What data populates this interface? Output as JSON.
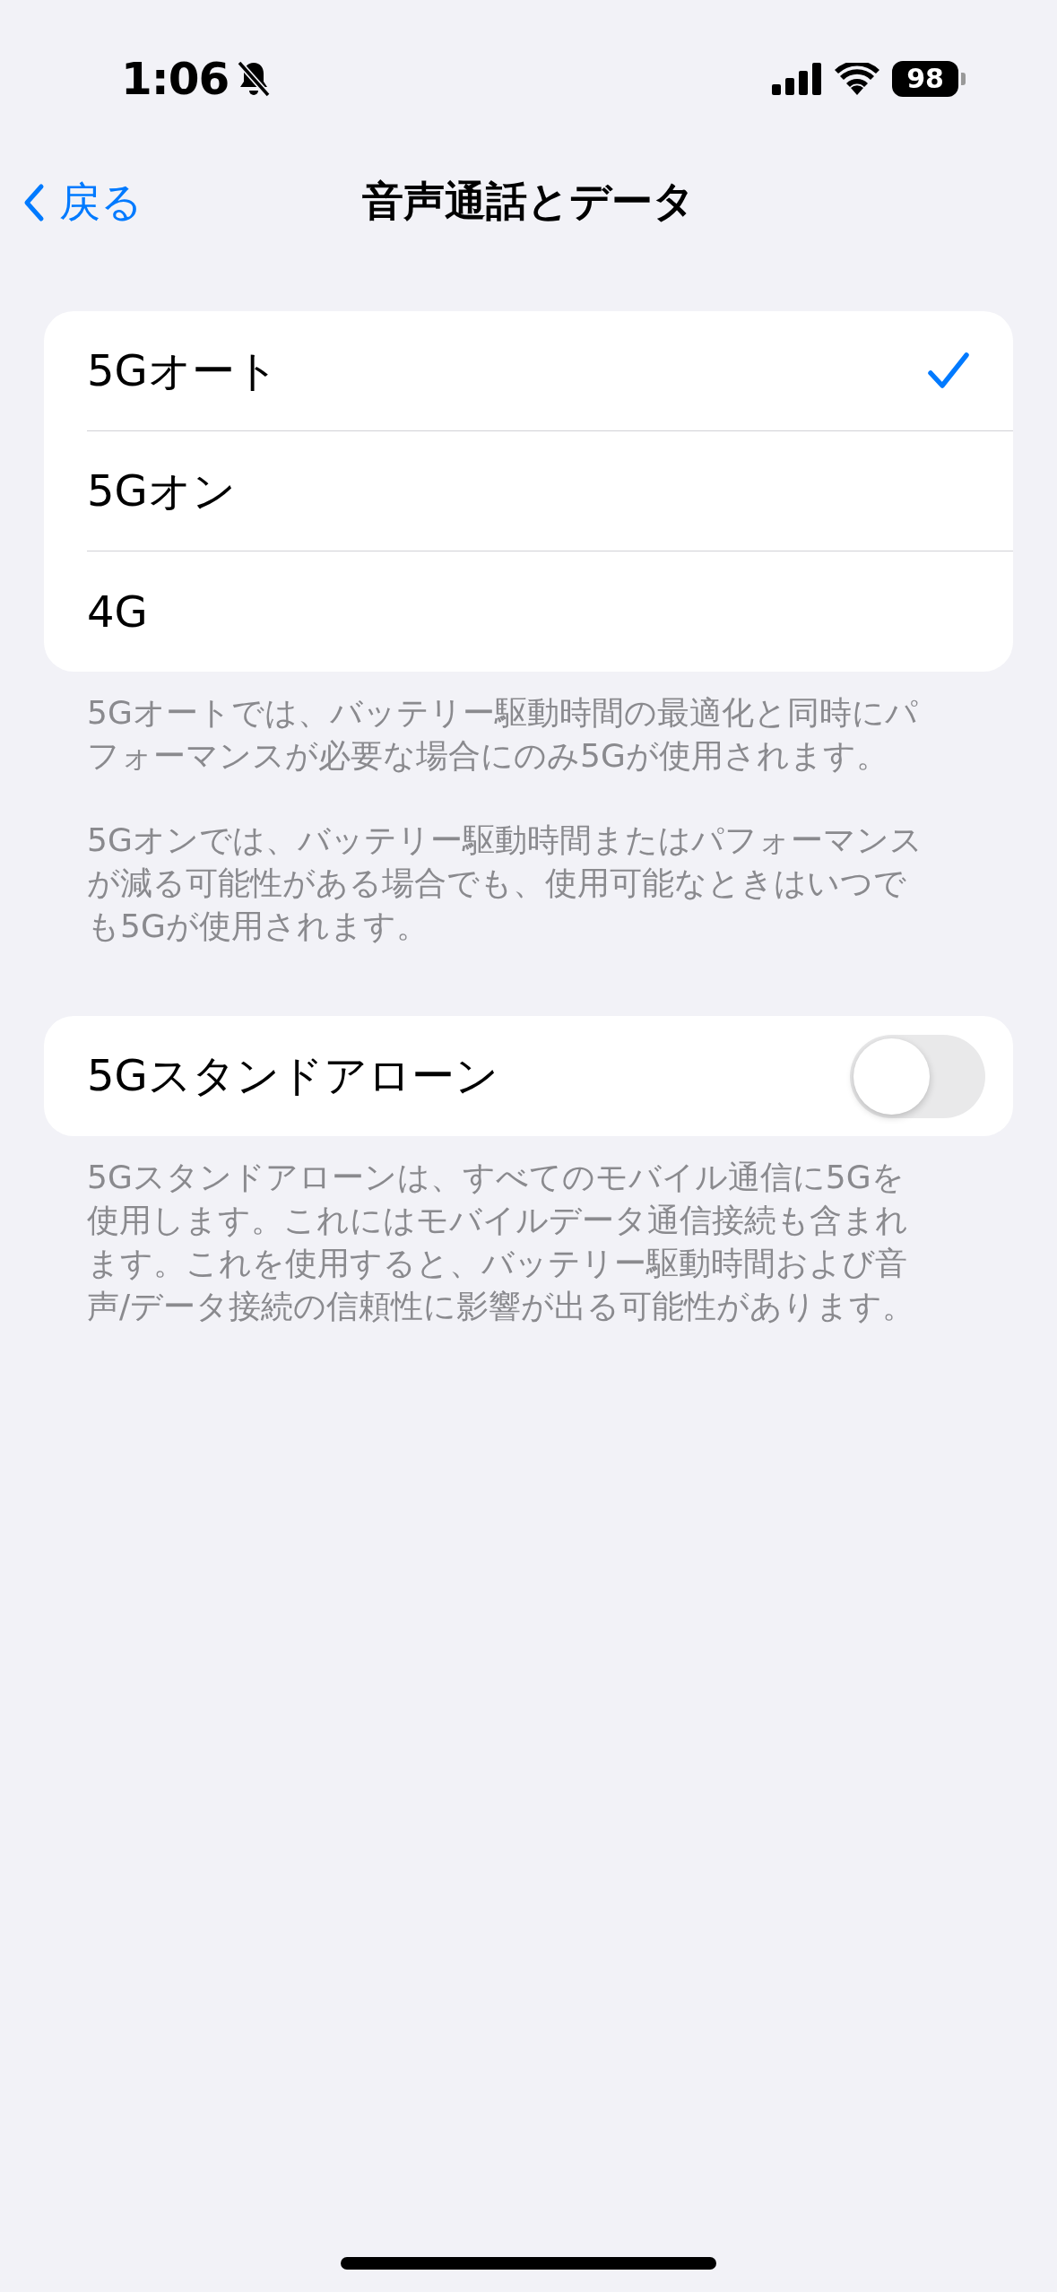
{
  "status_bar": {
    "time": "1:06",
    "silent": true,
    "battery": "98"
  },
  "nav": {
    "back": "戻る",
    "title": "音声通話とデータ"
  },
  "options": [
    {
      "label": "5Gオート",
      "selected": true
    },
    {
      "label": "5Gオン",
      "selected": false
    },
    {
      "label": "4G",
      "selected": false
    }
  ],
  "option_notes": [
    "5Gオートでは、バッテリー駆動時間の最適化と同時にパフォーマンスが必要な場合にのみ5Gが使用されます。",
    "5Gオンでは、バッテリー駆動時間またはパフォーマンスが減る可能性がある場合でも、使用可能なときはいつでも5Gが使用されます。"
  ],
  "standalone": {
    "label": "5Gスタンドアローン",
    "on": false,
    "note": "5Gスタンドアローンは、すべてのモバイル通信に5Gを使用します。これにはモバイルデータ通信接続も含まれます。これを使用すると、バッテリー駆動時間および音声/データ接続の信頼性に影響が出る可能性があります。"
  }
}
